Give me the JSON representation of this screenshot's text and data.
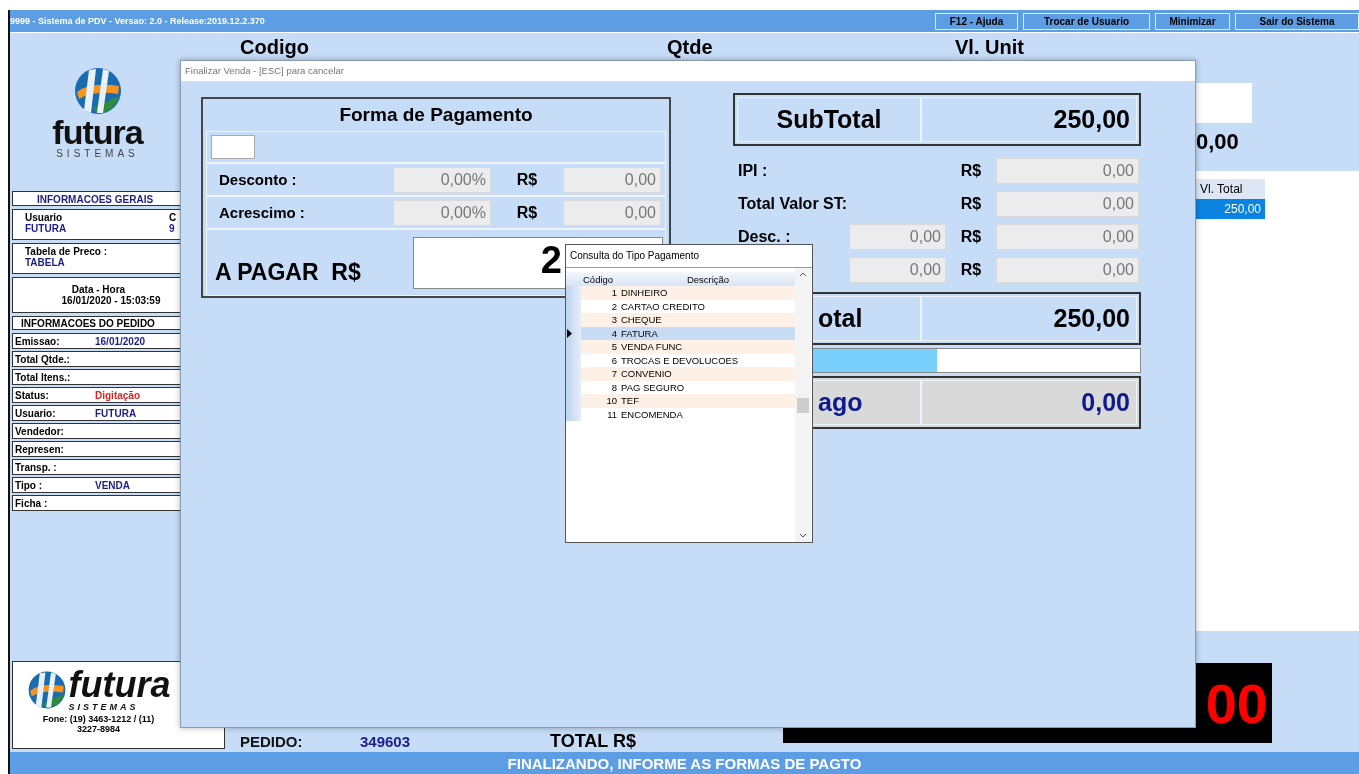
{
  "window": {
    "title": "9999 - Sistema de PDV - Versao: 2.0 - Release:2019.12.2.370",
    "buttons": [
      "F12 - Ajuda",
      "Trocar de Usuario",
      "Minimizar",
      "Sair do Sistema"
    ]
  },
  "sidebar": {
    "logo": {
      "brand": "futura",
      "tagline": "SISTEMAS"
    },
    "general": {
      "title": "INFORMACOES GERAIS",
      "user_label": "Usuario",
      "user": "FUTURA",
      "column_2_label": "C",
      "column_2_value": "9",
      "price_table_label": "Tabela de Preco :",
      "price_table": "TABELA",
      "datetime_label": "Data - Hora",
      "datetime": "16/01/2020 - 15:03:59"
    },
    "order_title": "INFORMACOES DO PEDIDO",
    "order_fields": [
      {
        "label": "Emissao:",
        "value": "16/01/2020",
        "color": "#1c1c8c"
      },
      {
        "label": "Total Qtde.:"
      },
      {
        "label": "Total Itens.:"
      },
      {
        "label": "Status:",
        "value": "Digitação",
        "color": "#e02020"
      },
      {
        "label": "Usuario:",
        "value": "FUTURA",
        "color": "#1c1c8c"
      },
      {
        "label": "Vendedor:"
      },
      {
        "label": "Represen:"
      },
      {
        "label": "Transp. :"
      },
      {
        "label": "Tipo :",
        "value": "VENDA",
        "color": "#1c1c8c"
      },
      {
        "label": "Ficha :"
      }
    ],
    "footer": {
      "brand": "futura",
      "tagline": "SISTEMAS",
      "phone": "Fone: (19) 3463-1212 / (11) 3227-8984"
    }
  },
  "grid": {
    "columns": [
      "Codigo",
      "Qtde",
      "Vl. Unit"
    ],
    "total_value": "0,00",
    "column_4": "Vl. Total",
    "rows": [
      {
        "value": "250,00",
        "selected": true
      }
    ]
  },
  "footer": {
    "order_label": "PEDIDO:",
    "order_number": "349603",
    "total_label": "TOTAL R$",
    "total": "00"
  },
  "status_bar": "FINALIZANDO, INFORME AS FORMAS DE PAGTO",
  "dialog": {
    "title": "Finalizar Venda - [ESC] para cancelar",
    "payment": {
      "title": "Forma de Pagamento",
      "rows": [
        {
          "label": "Desconto :",
          "percent": "0,00%",
          "currency": "R$",
          "amount": "0,00"
        },
        {
          "label": "Acrescimo :",
          "percent": "0,00%",
          "currency": "R$",
          "amount": "0,00"
        }
      ],
      "due_label": "A PAGAR  R$",
      "due": "2"
    },
    "subtotal": {
      "label": "SubTotal",
      "value": "250,00"
    },
    "lines": [
      {
        "label": "IPI :",
        "currency": "R$",
        "amount": "0,00"
      },
      {
        "label": "Total Valor ST:",
        "currency": "R$",
        "amount": "0,00"
      },
      {
        "label": "Desc. :",
        "base": "0,00",
        "currency": "R$",
        "amount": "0,00"
      },
      {
        "base": "0,00",
        "currency": "R$",
        "amount": "0,00"
      }
    ],
    "total": {
      "label": "otal",
      "value": "250,00"
    },
    "progress": {
      "level": 0.5
    },
    "paid": {
      "label": "ago",
      "value": "0,00"
    }
  },
  "popup": {
    "title": "Consulta do Tipo Pagamento",
    "columns": [
      "Código",
      "Descrição"
    ],
    "rows": [
      {
        "code": "1",
        "description": "DINHEIRO",
        "selected": false
      },
      {
        "code": "2",
        "description": "CARTAO CREDITO",
        "selected": false
      },
      {
        "code": "3",
        "description": "CHEQUE",
        "selected": false
      },
      {
        "code": "4",
        "description": "FATURA",
        "selected": true
      },
      {
        "code": "5",
        "description": "VENDA FUNC",
        "selected": false
      },
      {
        "code": "6",
        "description": "TROCAS E DEVOLUCOES",
        "selected": false
      },
      {
        "code": "7",
        "description": "CONVENIO",
        "selected": false
      },
      {
        "code": "8",
        "description": "PAG SEGURO",
        "selected": false
      },
      {
        "code": "10",
        "description": "TEF",
        "selected": false
      },
      {
        "code": "11",
        "description": "ENCOMENDA",
        "selected": false
      }
    ]
  }
}
